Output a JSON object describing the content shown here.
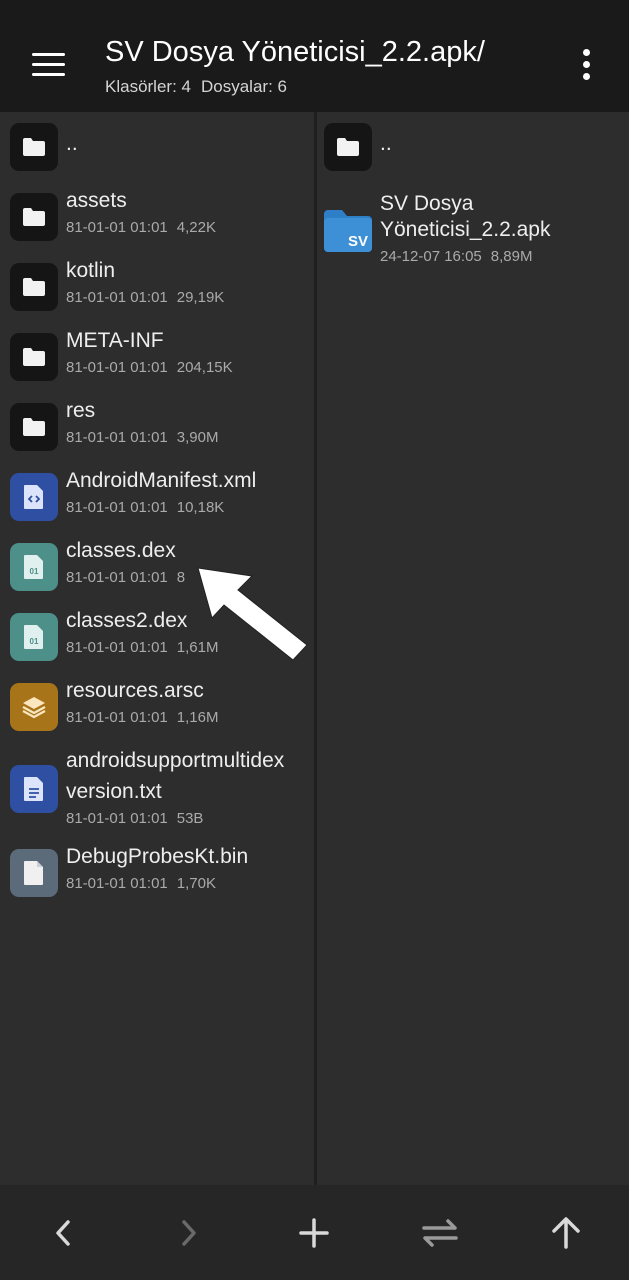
{
  "header": {
    "title": "SV Dosya Yöneticisi_2.2.apk/",
    "folders_label": "Klasörler: 4",
    "files_label": "Dosyalar: 6"
  },
  "left_pane": {
    "parent": {
      "name": ".."
    },
    "items": [
      {
        "name": "assets",
        "date": "81-01-01 01:01",
        "size": "4,22K",
        "icon": "folder-icon"
      },
      {
        "name": "kotlin",
        "date": "81-01-01 01:01",
        "size": "29,19K",
        "icon": "folder-icon"
      },
      {
        "name": "META-INF",
        "date": "81-01-01 01:01",
        "size": "204,15K",
        "icon": "folder-icon"
      },
      {
        "name": "res",
        "date": "81-01-01 01:01",
        "size": "3,90M",
        "icon": "folder-icon"
      },
      {
        "name": "AndroidManifest.xml",
        "date": "81-01-01 01:01",
        "size": "10,18K",
        "icon": "code-file-icon"
      },
      {
        "name": "classes.dex",
        "date": "81-01-01 01:01",
        "size": "8",
        "icon": "binary-file-icon"
      },
      {
        "name": "classes2.dex",
        "date": "81-01-01 01:01",
        "size": "1,61M",
        "icon": "binary-file-icon"
      },
      {
        "name": "resources.arsc",
        "date": "81-01-01 01:01",
        "size": "1,16M",
        "icon": "layers-icon"
      },
      {
        "name_line1": "androidsupportmultidex",
        "name_line2": "version.txt",
        "date": "81-01-01 01:01",
        "size": "53B",
        "icon": "text-file-icon"
      },
      {
        "name": "DebugProbesKt.bin",
        "date": "81-01-01 01:01",
        "size": "1,70K",
        "icon": "file-icon"
      }
    ]
  },
  "right_pane": {
    "parent": {
      "name": ".."
    },
    "apk": {
      "name_line1": "SV Dosya",
      "name_line2": "Yöneticisi_2.2.apk",
      "date": "24-12-07 16:05",
      "size": "8,89M",
      "badge": "SV",
      "icon": "apk-folder-icon"
    }
  },
  "colors": {
    "topbar": "#1a1a1a",
    "background": "#2d2d2d",
    "folder_tile": "#151515",
    "code_tile": "#2f4fa2",
    "dex_tile": "#4d8f89",
    "arsc_tile": "#a8741a",
    "bin_tile": "#5c6b7a",
    "apk_folder": "#3d8fd6"
  },
  "bottom_bar": {
    "buttons": [
      "back-icon",
      "forward-icon",
      "add-icon",
      "swap-icon",
      "up-icon"
    ]
  }
}
